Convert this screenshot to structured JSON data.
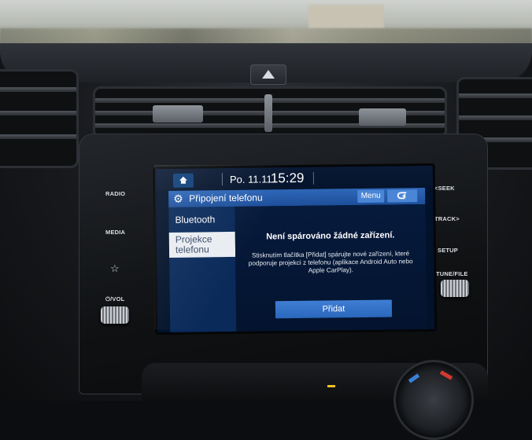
{
  "status": {
    "date": "Po. 11.11",
    "time": "15:29"
  },
  "header": {
    "title": "Připojení telefonu",
    "menu_label": "Menu"
  },
  "sidebar": {
    "items": [
      {
        "label": "Bluetooth",
        "active": false
      },
      {
        "label": "Projekce telefonu",
        "active": true
      }
    ]
  },
  "content": {
    "message_title": "Není spárováno žádné zařízení.",
    "message_body": "Stisknutím tlačítka [Přidat] spárujte nové zařízení, které podporuje projekci z telefonu (aplikace Android Auto nebo Apple CarPlay).",
    "add_button_label": "Přidat"
  },
  "physical_buttons": {
    "left": [
      "RADIO",
      "MEDIA",
      "☆",
      "⏻/VOL"
    ],
    "right": [
      "<SEEK",
      "TRACK>",
      "SETUP",
      "TUNE/FILE"
    ]
  },
  "icons": {
    "home": "home-icon",
    "settings": "gear-icon",
    "back": "back-arrow-icon",
    "hazard": "hazard-triangle-icon"
  },
  "colors": {
    "accent": "#2e67b8",
    "button": "#3f7ed4",
    "screen_bg": "#04142f",
    "active_item_bg": "#e9edf2"
  }
}
